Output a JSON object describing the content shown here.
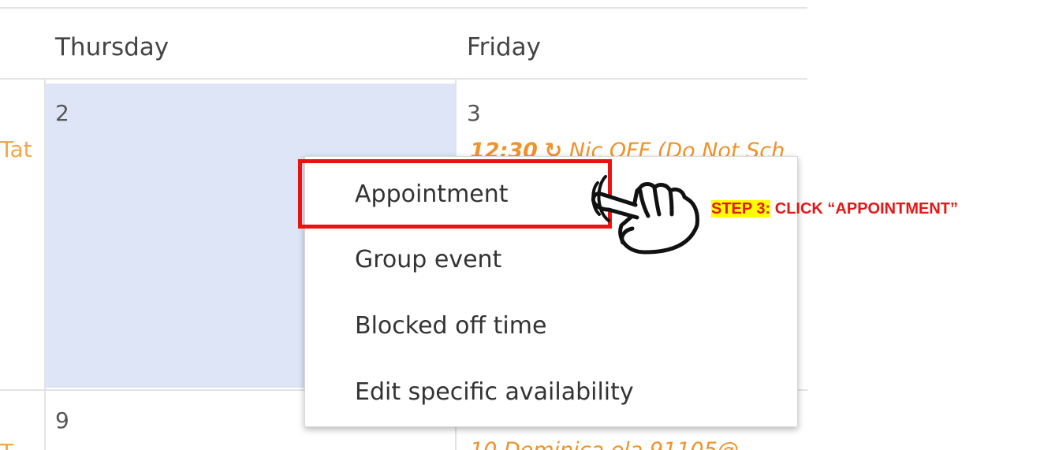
{
  "calendar": {
    "headers": [
      "Thursday",
      "Friday"
    ],
    "left_cut_text": "Tat",
    "left_cut_text_bottom": "T",
    "week1": {
      "thursday_date": "2",
      "friday_date": "3",
      "friday_event": {
        "time": "12:30",
        "recurring_icon": "recurring-arrow-icon",
        "title": "Nic OFF (Do Not Sch"
      }
    },
    "week2": {
      "thursday_date": "9",
      "friday_event_partial": "10 Dominica.ela 91105@"
    }
  },
  "context_menu": {
    "items": [
      {
        "label": "Appointment"
      },
      {
        "label": "Group event"
      },
      {
        "label": "Blocked off time"
      },
      {
        "label": "Edit specific availability"
      }
    ]
  },
  "annotation": {
    "step_tag": "STEP 3:",
    "step_text": " CLICK “APPOINTMENT”",
    "pointer_icon": "hand-pointer-icon",
    "highlight_color": "#ee1111",
    "tag_background": "#ffff00"
  },
  "colors": {
    "selected_cell": "#dde5f6",
    "event_orange": "#f0932b",
    "grid_line": "#e3e3e3"
  }
}
